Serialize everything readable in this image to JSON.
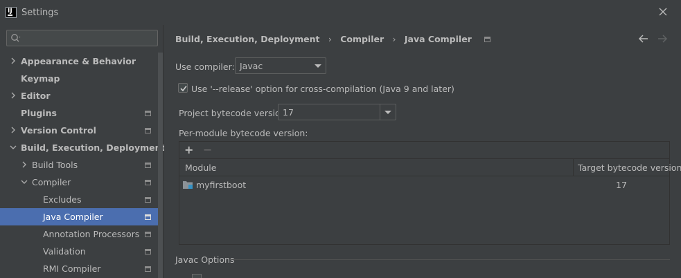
{
  "window": {
    "title": "Settings",
    "logo_text": "IJ"
  },
  "search": {
    "placeholder": "",
    "value": ""
  },
  "sidebar": {
    "items": [
      {
        "label": "Appearance & Behavior",
        "bold": true,
        "expandable": true,
        "expanded": false,
        "project_icon": false
      },
      {
        "label": "Keymap",
        "bold": true,
        "expandable": false,
        "project_icon": false
      },
      {
        "label": "Editor",
        "bold": true,
        "expandable": true,
        "expanded": false,
        "project_icon": false
      },
      {
        "label": "Plugins",
        "bold": true,
        "expandable": false,
        "project_icon": true
      },
      {
        "label": "Version Control",
        "bold": true,
        "expandable": true,
        "expanded": false,
        "project_icon": true
      },
      {
        "label": "Build, Execution, Deployment",
        "bold": true,
        "expandable": true,
        "expanded": true,
        "project_icon": false
      },
      {
        "label": "Build Tools",
        "bold": false,
        "expandable": true,
        "expanded": false,
        "project_icon": true
      },
      {
        "label": "Compiler",
        "bold": false,
        "expandable": true,
        "expanded": true,
        "project_icon": true
      },
      {
        "label": "Excludes",
        "bold": false,
        "expandable": false,
        "project_icon": true
      },
      {
        "label": "Java Compiler",
        "bold": false,
        "expandable": false,
        "project_icon": true,
        "selected": true
      },
      {
        "label": "Annotation Processors",
        "bold": false,
        "expandable": false,
        "project_icon": true
      },
      {
        "label": "Validation",
        "bold": false,
        "expandable": false,
        "project_icon": true
      },
      {
        "label": "RMI Compiler",
        "bold": false,
        "expandable": false,
        "project_icon": true
      }
    ]
  },
  "breadcrumb": {
    "items": [
      "Build, Execution, Deployment",
      "Compiler",
      "Java Compiler"
    ],
    "separator": "›"
  },
  "form": {
    "use_compiler_label": "Use compiler:",
    "use_compiler_value": "Javac",
    "release_option_label": "Use '--release' option for cross-compilation (Java 9 and later)",
    "release_option_checked": true,
    "project_bytecode_label": "Project bytecode version:",
    "project_bytecode_value": "17",
    "per_module_label": "Per-module bytecode version:"
  },
  "module_table": {
    "add_label": "+",
    "remove_label": "−",
    "columns": [
      "Module",
      "Target bytecode version"
    ],
    "rows": [
      {
        "module": "myfirstboot",
        "target": "17"
      }
    ]
  },
  "javac_options": {
    "title": "Javac Options"
  },
  "colors": {
    "background": "#3c3f41",
    "selection": "#4b6eaf",
    "text": "#bbbbbb",
    "folder_accent": "#3592c4"
  }
}
